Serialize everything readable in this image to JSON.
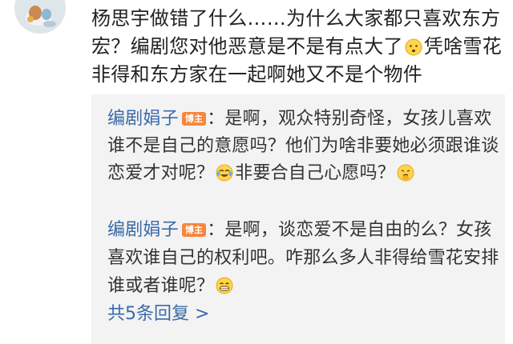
{
  "comment": {
    "text_part1": "杨思宇做错了什么……为什么大家都只喜欢东方宏？编剧您对他恶意是不是有点大了",
    "emoji": "sad-face-emoji",
    "text_part2": "凭啥雪花非得和东方家在一起啊她又不是个物件"
  },
  "replies": [
    {
      "author": "编剧娟子",
      "badge": "博主",
      "text_part1": "：是啊，观众特别奇怪，女孩儿喜欢谁不是自己的意愿吗？他们为啥非要她必须跟谁谈恋爱才对呢？",
      "emoji1": "laugh-cry-emoji",
      "text_part2": "非要合自己心愿吗？",
      "emoji2": "thinking-emoji"
    },
    {
      "author": "编剧娟子",
      "badge": "博主",
      "text_part1": "：是啊，谈恋爱不是自由的么？女孩喜欢谁自己的权利吧。咋那么多人非得给雪花安排谁或者谁呢？",
      "emoji1": "grin-emoji"
    }
  ],
  "more_replies": "共5条回复 >",
  "colors": {
    "author": "#3b6aa8",
    "badge": "#f7863b",
    "reply_bg": "#f3f3f3",
    "text": "#222222"
  }
}
